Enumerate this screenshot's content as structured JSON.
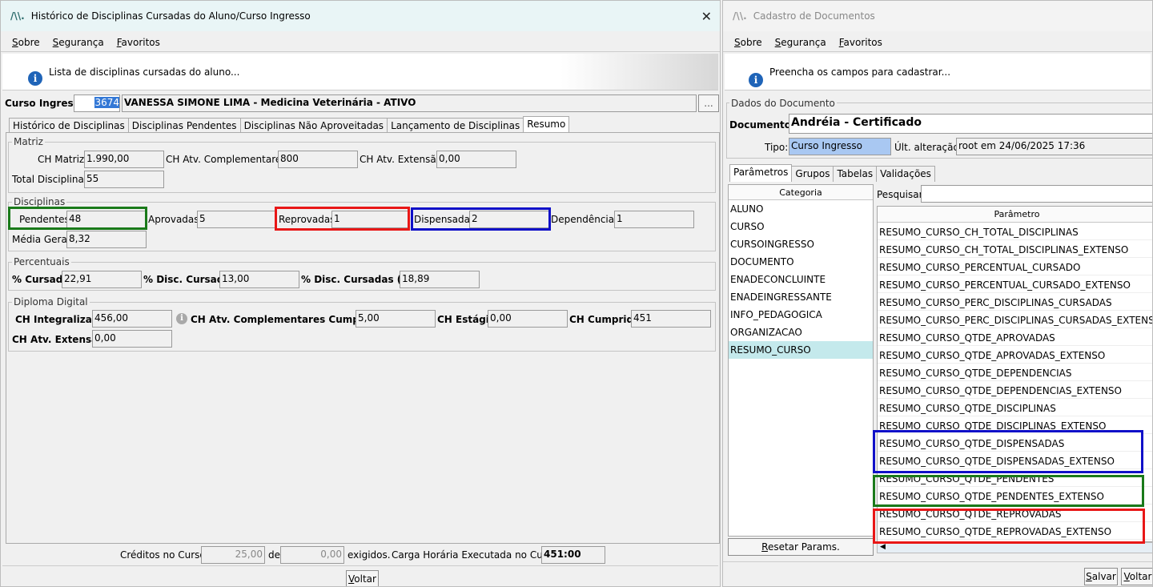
{
  "win1": {
    "title": "Histórico de Disciplinas Cursadas do Aluno/Curso Ingresso",
    "logo": "/\\\\.",
    "menu": [
      "Sobre",
      "Segurança",
      "Favoritos"
    ],
    "info": "Lista de disciplinas cursadas do aluno...",
    "curso_label": "Curso Ingresso:",
    "curso_code": "3674",
    "curso_name": "VANESSA SIMONE LIMA - Medicina Veterinária - ATIVO",
    "ellipsis": "...",
    "tabs": [
      "Histórico de Disciplinas",
      "Disciplinas Pendentes",
      "Disciplinas Não Aproveitadas",
      "Lançamento de Disciplinas",
      "Resumo"
    ],
    "matriz": {
      "title": "Matriz",
      "ch_matriz_label": "CH Matriz:",
      "ch_matriz": "1.990,00",
      "ch_comp_label": "CH Atv. Complementares:",
      "ch_comp": "800",
      "ch_ext_label": "CH Atv. Extensão:",
      "ch_ext": "0,00",
      "total_label": "Total Disciplinas:",
      "total": "55"
    },
    "disciplinas": {
      "title": "Disciplinas",
      "pend_label": "Pendentes:",
      "pend": "48",
      "aprov_label": "Aprovadas:",
      "aprov": "5",
      "reprov_label": "Reprovadas:",
      "reprov": "1",
      "disp_label": "Dispensadas:",
      "disp": "2",
      "dep_label": "Dependências:",
      "dep": "1",
      "media_label": "Média Geral:",
      "media": "8,32"
    },
    "percentuais": {
      "title": "Percentuais",
      "cursado_label": "% Cursado:",
      "cursado": "22,91",
      "disc_label": "% Disc. Cursadas:",
      "disc": "13,00",
      "disc_hr_label": "% Disc. Cursadas (HR):",
      "disc_hr": "18,89"
    },
    "diploma": {
      "title": "Diploma Digital",
      "integ_label": "CH Integralizada:",
      "integ": "456,00",
      "comp_label": "CH Atv. Complementares Cumpridas:",
      "comp": "5,00",
      "estagio_label": "CH Estágio:",
      "estagio": "0,00",
      "cumprida_label": "CH Cumprida:",
      "cumprida": "451",
      "ext_label": "CH Atv. Extensão:",
      "ext": "0,00"
    },
    "footer": {
      "creditos_label": "Créditos no Curso:",
      "creditos": "25,00",
      "de": "de",
      "exigidos_val": "0,00",
      "exigidos": "exigidos.",
      "carga_label": "Carga Horária Executada no Curso:",
      "carga": "451:00"
    },
    "voltar": "Voltar"
  },
  "win2": {
    "title": "Cadastro de Documentos",
    "logo": "/\\\\.",
    "menu": [
      "Sobre",
      "Segurança",
      "Favoritos"
    ],
    "info": "Preencha os campos para cadastrar...",
    "group_title": "Dados do Documento",
    "doc_label": "Documento:",
    "doc": "Andréia - Certificado",
    "tipo_label": "Tipo:",
    "tipo": "Curso Ingresso",
    "ult_label": "Últ. alteração:",
    "ult": "root em 24/06/2025 17:36",
    "tabs": [
      "Parâmetros",
      "Grupos",
      "Tabelas",
      "Validações"
    ],
    "categoria_hdr": "Categoria",
    "categorias": [
      "ALUNO",
      "CURSO",
      "CURSOINGRESSO",
      "DOCUMENTO",
      "ENADECONCLUINTE",
      "ENADEINGRESSANTE",
      "INFO_PEDAGOGICA",
      "ORGANIZACAO",
      "RESUMO_CURSO"
    ],
    "pesquisar_label": "Pesquisar:",
    "parametro_hdr": "Parâmetro",
    "parametros": [
      "RESUMO_CURSO_CH_TOTAL_DISCIPLINAS",
      "RESUMO_CURSO_CH_TOTAL_DISCIPLINAS_EXTENSO",
      "RESUMO_CURSO_PERCENTUAL_CURSADO",
      "RESUMO_CURSO_PERCENTUAL_CURSADO_EXTENSO",
      "RESUMO_CURSO_PERC_DISCIPLINAS_CURSADAS",
      "RESUMO_CURSO_PERC_DISCIPLINAS_CURSADAS_EXTENSO",
      "RESUMO_CURSO_QTDE_APROVADAS",
      "RESUMO_CURSO_QTDE_APROVADAS_EXTENSO",
      "RESUMO_CURSO_QTDE_DEPENDENCIAS",
      "RESUMO_CURSO_QTDE_DEPENDENCIAS_EXTENSO",
      "RESUMO_CURSO_QTDE_DISCIPLINAS",
      "RESUMO_CURSO_QTDE_DISCIPLINAS_EXTENSO",
      "RESUMO_CURSO_QTDE_DISPENSADAS",
      "RESUMO_CURSO_QTDE_DISPENSADAS_EXTENSO",
      "RESUMO_CURSO_QTDE_PENDENTES",
      "RESUMO_CURSO_QTDE_PENDENTES_EXTENSO",
      "RESUMO_CURSO_QTDE_REPROVADAS",
      "RESUMO_CURSO_QTDE_REPROVADAS_EXTENSO"
    ],
    "resetar": "Resetar Params.",
    "salvar": "Salvar",
    "voltar": "Voltar"
  },
  "colors": {
    "green": "#1a7a1a",
    "red": "#e81717",
    "blue": "#1010c8",
    "selected": "#c4e9ec"
  }
}
